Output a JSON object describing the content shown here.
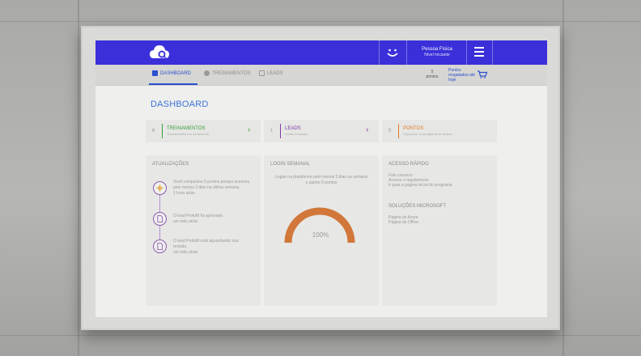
{
  "header": {
    "user_name": "Pessoa Física",
    "user_level": "Nível Iniciante"
  },
  "nav": {
    "dashboard": "DASHBOARD",
    "treinamentos": "TREINAMENTOS",
    "leads": "LEADS",
    "points_value": "5",
    "points_label": "pontos",
    "points_link": "Pontos resgatados até hoje"
  },
  "page": {
    "title": "DASHBOARD"
  },
  "cards": [
    {
      "num": "6",
      "title": "TREINAMENTOS",
      "sub": "Treinamentos em andamento",
      "color": "#3aa03a"
    },
    {
      "num": "1",
      "title": "LEADS",
      "sub": "Leads enviados",
      "color": "#7a3aa8"
    },
    {
      "num": "5",
      "title": "PONTOS",
      "sub": "Seja parte do programa de pontos",
      "color": "#e07a2a"
    }
  ],
  "updates": {
    "title": "ATUALIZAÇÕES",
    "items": [
      {
        "text": "Você conquistou 5 pontos porque acessou pelo menos 3 dias na última semana.",
        "time": "1 hora atrás"
      },
      {
        "text": "O lead ProtoM foi aprovado.",
        "time": "um mês atrás"
      },
      {
        "text": "O lead ProtoM está aguardando sua revisão.",
        "time": "um mês atrás"
      }
    ]
  },
  "weekly": {
    "title": "LOGIN SEMANAL",
    "text": "Logue na plataforma pelo menos 3 dias na semana e ganhe 5 pontos",
    "progress": 100,
    "progress_label": "100%",
    "accent": "#d2773a"
  },
  "quick": {
    "title": "ACESSO RÁPIDO",
    "links": [
      "Fale conosco",
      "Acesse o regulamento",
      "Ir para a página inicial do programa"
    ],
    "ms_title": "SOLUÇÕES MICROSOFT",
    "ms_links": [
      "Página do Azure",
      "Página do Office"
    ]
  },
  "colors": {
    "topbar": "#3a2fd9",
    "accent": "#3b74d8",
    "timeline": "#8c5bb0"
  }
}
